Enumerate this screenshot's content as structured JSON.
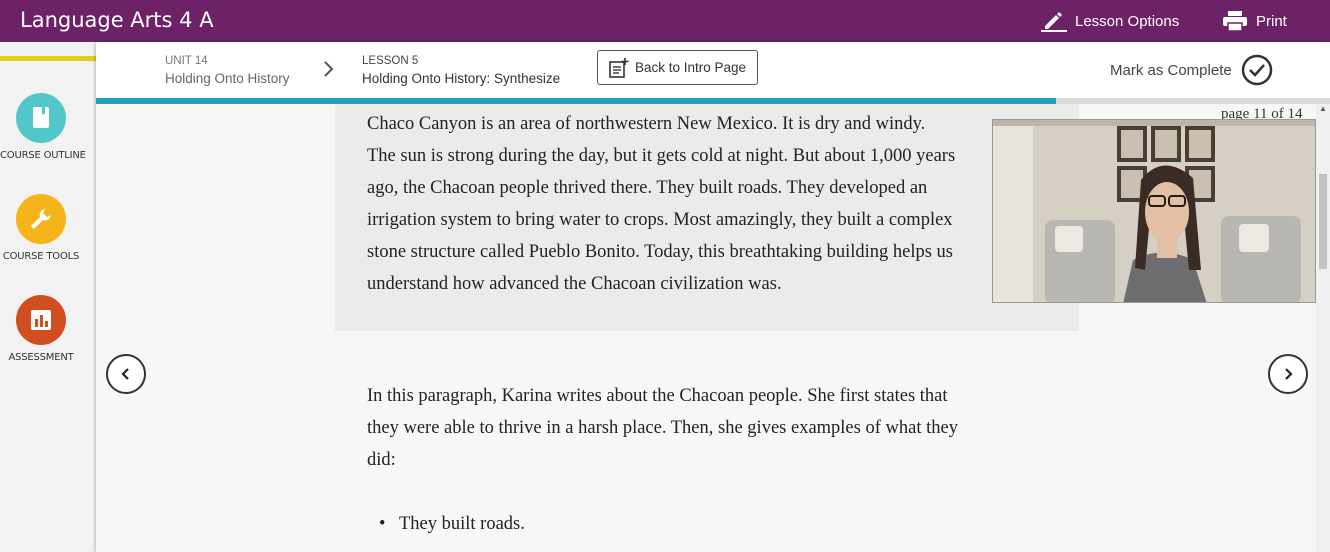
{
  "app": {
    "title": "Language Arts 4 A"
  },
  "top_actions": {
    "lesson_options": "Lesson Options",
    "print": "Print"
  },
  "sidebar": {
    "items": [
      {
        "label": "COURSE OUTLINE",
        "icon": "book-icon",
        "color": "#52c7c9"
      },
      {
        "label": "COURSE TOOLS",
        "icon": "wrench-icon",
        "color": "#f4b41a"
      },
      {
        "label": "ASSESSMENT",
        "icon": "bar-chart-icon",
        "color": "#d14f1e"
      }
    ]
  },
  "breadcrumb": {
    "unit_label": "UNIT 14",
    "unit_title": "Holding Onto History",
    "lesson_label": "LESSON 5",
    "lesson_title": "Holding Onto History: Synthesize"
  },
  "header": {
    "back_button": "Back to Intro Page",
    "mark_complete": "Mark as Complete"
  },
  "progress": {
    "fraction": 0.778
  },
  "page_indicator": "page 11 of 14",
  "quote": {
    "lines": [
      "Chaco Canyon is an area of northwestern New Mexico. It is dry and windy.",
      "The sun is strong during the day, but it gets cold at night. But about 1,000 years",
      "ago, the Chacoan people thrived there. They built roads. They developed an",
      "irrigation system to bring water to crops. Most amazingly, they built a complex",
      "stone structure called Pueblo Bonito. Today, this breathtaking building helps us",
      "understand how advanced the Chacoan civilization was."
    ]
  },
  "paragraph": {
    "lines": [
      "In this paragraph, Karina writes about the Chacoan people. She first states that",
      "they were able to thrive in a harsh place. Then, she gives examples of what they",
      "did:"
    ]
  },
  "bullets": [
    "They built roads."
  ],
  "colors": {
    "topbar": "#6d2268",
    "accent": "#e4cd1c",
    "progress": "#1ca5b8"
  }
}
